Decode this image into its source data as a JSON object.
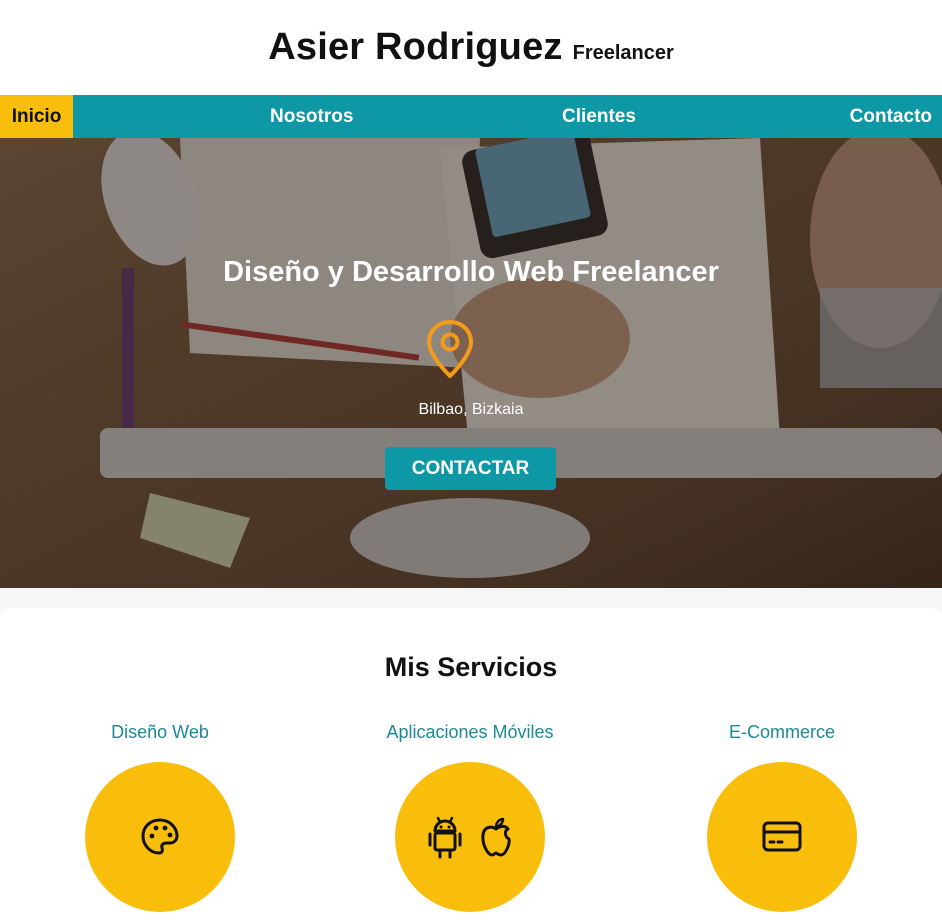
{
  "header": {
    "name": "Asier Rodriguez",
    "role": "Freelancer"
  },
  "nav": {
    "items": [
      {
        "label": "Inicio",
        "active": true
      },
      {
        "label": "Nosotros"
      },
      {
        "label": "Clientes"
      },
      {
        "label": "Contacto"
      }
    ]
  },
  "hero": {
    "title": "Diseño y Desarrollo Web Freelancer",
    "location_icon": "map-pin-icon",
    "location": "Bilbao, Bizkaia",
    "cta_label": "CONTACTAR"
  },
  "services": {
    "title": "Mis Servicios",
    "items": [
      {
        "label": "Diseño Web",
        "icons": [
          "palette-icon"
        ]
      },
      {
        "label": "Aplicaciones Móviles",
        "icons": [
          "android-icon",
          "apple-icon"
        ]
      },
      {
        "label": "E-Commerce",
        "icons": [
          "credit-card-icon"
        ]
      }
    ]
  },
  "colors": {
    "teal": "#0e97a5",
    "yellow": "#f9bd0b",
    "pin_orange": "#f59b1c",
    "service_label": "#1b8a96"
  }
}
